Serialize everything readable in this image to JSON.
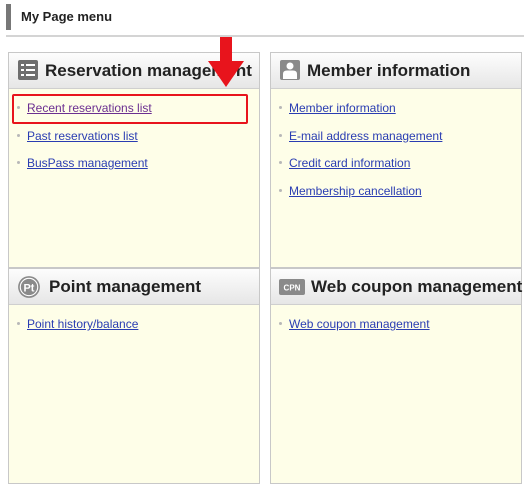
{
  "page": {
    "title": "My Page menu"
  },
  "panels": {
    "reservation": {
      "title": "Reservation management",
      "icon": "list-icon",
      "links": [
        "Recent reservations list",
        "Past reservations list",
        "BusPass management"
      ]
    },
    "member": {
      "title": "Member information",
      "icon": "person-icon",
      "links": [
        "Member information",
        "E-mail address management",
        "Credit card information",
        "Membership cancellation"
      ]
    },
    "point": {
      "title": "Point management",
      "icon": "pt-icon",
      "icon_text": "Pt",
      "links": [
        "Point history/balance"
      ]
    },
    "coupon": {
      "title": "Web coupon management",
      "icon": "cpn-icon",
      "icon_text": "CPN",
      "links": [
        "Web coupon management"
      ]
    }
  },
  "annotation": {
    "highlight_color": "#e8141c",
    "arrow_color": "#e8141c"
  },
  "colors": {
    "panel_bg": "#fefee8",
    "link": "#2a3db2",
    "visited_link": "#6b2f91"
  }
}
